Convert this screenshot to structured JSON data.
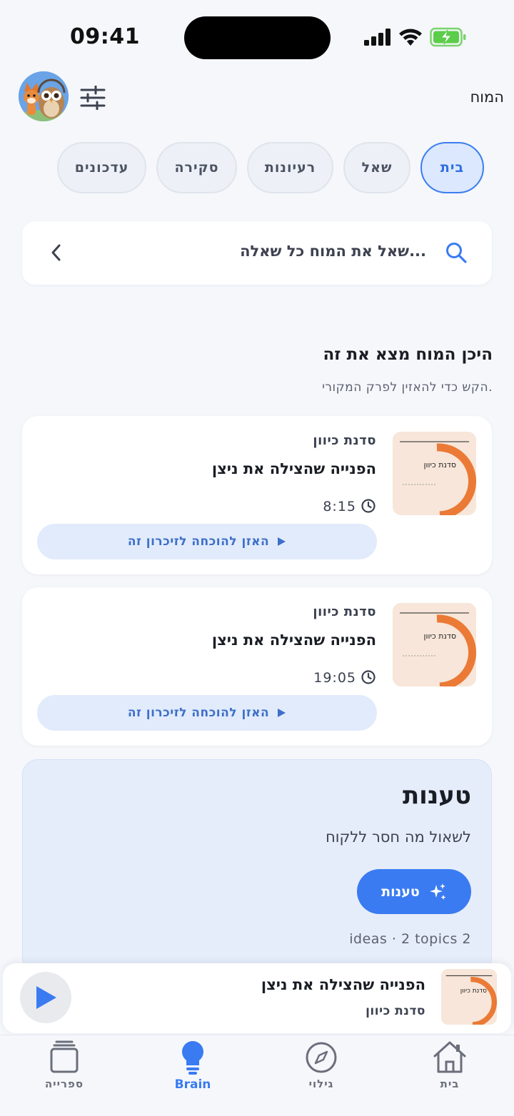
{
  "status_bar": {
    "time": "09:41"
  },
  "header": {
    "title": "המוח"
  },
  "tabs": [
    {
      "label": "בית",
      "active": true
    },
    {
      "label": "שאל",
      "active": false
    },
    {
      "label": "רעיונות",
      "active": false
    },
    {
      "label": "סקירה",
      "active": false
    },
    {
      "label": "עדכונים",
      "active": false
    }
  ],
  "search": {
    "placeholder": "שאל את המוח כל שאלה..."
  },
  "section": {
    "title": "היכן המוח מצא את זה",
    "subtitle": "הקש כדי להאזין לפרק המקורי."
  },
  "results": [
    {
      "show": "סדנת כיוון",
      "title": "הפנייה שהצילה את ניצן",
      "time": "8:15",
      "button": "האזן להוכחה לזיכרון זה",
      "thumb_text": "סדנת כיוון"
    },
    {
      "show": "סדנת כיוון",
      "title": "הפנייה שהצילה את ניצן",
      "time": "19:05",
      "button": "האזן להוכחה לזיכרון זה",
      "thumb_text": "סדנת כיוון"
    }
  ],
  "promo": {
    "title": "טענות",
    "subtitle": "לשאול מה חסר ללקוח",
    "button": "טענות",
    "meta": "ideas · 2 topics 2"
  },
  "player": {
    "title": "הפנייה שהצילה את ניצן",
    "show": "סדנת כיוון",
    "thumb_text": "סדנת כיוון"
  },
  "bottom_nav": [
    {
      "label": "ספרייה",
      "icon": "library-icon",
      "active": false
    },
    {
      "label": "Brain",
      "icon": "lightbulb-icon",
      "active": true
    },
    {
      "label": "גילוי",
      "icon": "compass-icon",
      "active": false
    },
    {
      "label": "בית",
      "icon": "home-icon",
      "active": false
    }
  ],
  "colors": {
    "accent": "#3a7bf2",
    "thumb_orange": "#ea7a35",
    "thumb_bg": "#f7e6d9"
  }
}
